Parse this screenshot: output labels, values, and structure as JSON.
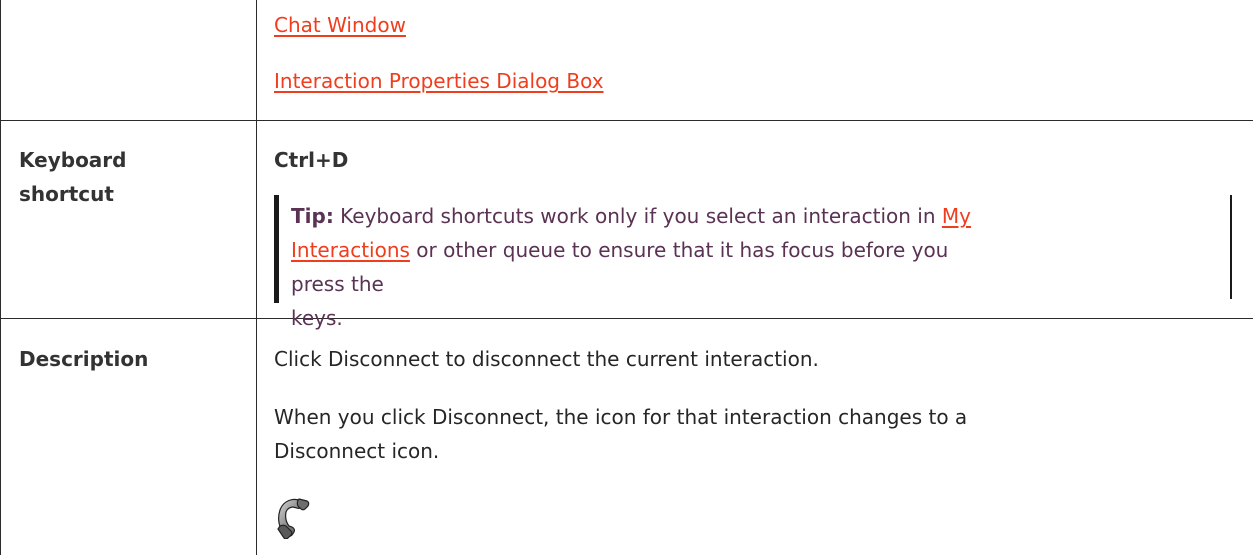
{
  "top_row": {
    "links": [
      {
        "label": "Chat Window"
      },
      {
        "label": "Interaction Properties Dialog Box"
      }
    ]
  },
  "keyboard_row": {
    "label_line1": "Keyboard",
    "label_line2": "shortcut",
    "shortcut": "Ctrl+D",
    "tip": {
      "label": "Tip:",
      "text_before_link": " Keyboard shortcuts work only if you select an interaction in ",
      "link_line1": "My",
      "link_line2": "Interactions",
      "text_after_link": " or other queue to ensure that it has focus before you press the",
      "text_end": "keys."
    }
  },
  "description_row": {
    "label": "Description",
    "paragraph1": "Click Disconnect to disconnect the current interaction.",
    "paragraph2_line1": "When you click Disconnect, the icon for that interaction changes to a",
    "paragraph2_line2": "Disconnect icon.",
    "icon": "disconnect-phone-icon"
  },
  "colors": {
    "link": "#ef3d1d",
    "tip_text": "#5a3253",
    "border": "#2b2b2b"
  }
}
